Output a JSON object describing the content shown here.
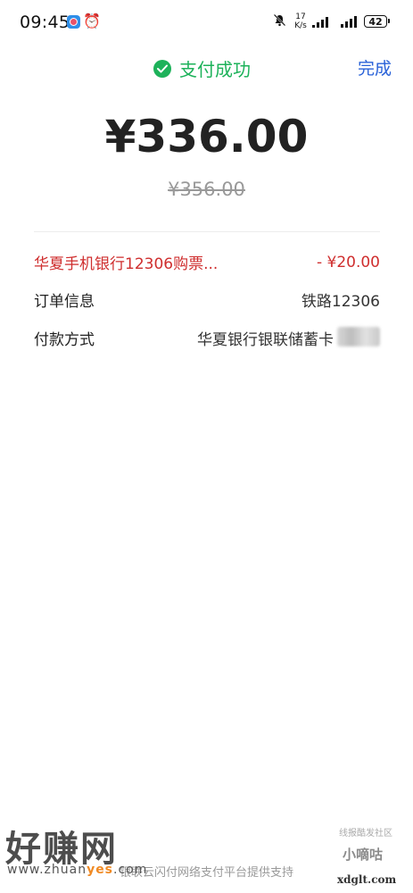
{
  "status_bar": {
    "time": "09:45",
    "speed_value": "17",
    "speed_unit": "K/s",
    "battery": "42",
    "icons": [
      "app-icon",
      "alarm-icon",
      "mute-icon",
      "signal-icon",
      "signal-icon",
      "battery-icon"
    ]
  },
  "header": {
    "status_text": "支付成功",
    "done_label": "完成",
    "status_color": "#1db25a",
    "done_color": "#2a62d8"
  },
  "amount": {
    "paid": "¥336.00",
    "original": "¥356.00"
  },
  "details": {
    "discount": {
      "label": "华夏手机银行12306购票...",
      "value": "- ¥20.00",
      "color": "#cf2e2e"
    },
    "order_info": {
      "label": "订单信息",
      "value": "铁路12306"
    },
    "payment_method": {
      "label": "付款方式",
      "value": "华夏银行银联储蓄卡"
    }
  },
  "footer": {
    "note": "银联云闪付网络支付平台提供支持"
  },
  "watermarks": {
    "left_title": "好赚网",
    "left_url_prefix": "www.zhuan",
    "left_url_highlight": "yes",
    "left_url_suffix": ".com",
    "right_top": "线报酷发社区",
    "right_logo": "小嘀咕",
    "right_url": "xdglt.com"
  }
}
